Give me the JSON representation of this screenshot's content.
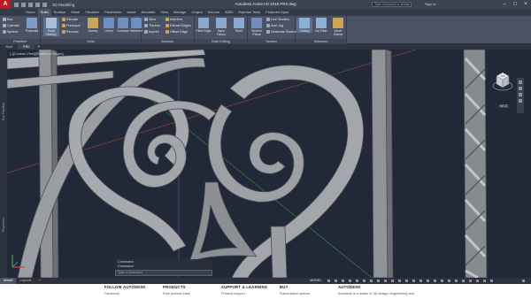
{
  "titlebar": {
    "app_logo": "A",
    "workspace": "3D Modeling",
    "title": "Autodesk AutoCAD 2019   PR2.dwg",
    "search_placeholder": "Type a keyword or phrase",
    "user": "Sign In",
    "minimize": "–",
    "maximize": "□",
    "close": "×"
  },
  "ribbon_tabs": [
    "Home",
    "Solid",
    "Surface",
    "Mesh",
    "Visualize",
    "Parametric",
    "Insert",
    "Annotate",
    "View",
    "Manage",
    "Output",
    "Add-ins",
    "A360",
    "Express Tools",
    "Featured Apps"
  ],
  "active_tab": "Solid",
  "ribbon": {
    "primitive": {
      "label": "Primitive",
      "items": [
        "Box",
        "Cylinder",
        "Sphere"
      ],
      "big": "Polysolid"
    },
    "solid": {
      "label": "Solid",
      "big": "Solid History",
      "items": [
        "Extrude",
        "Presspull",
        "Revolve"
      ],
      "items2": [
        "Sweep",
        "Union",
        "Subtract",
        "Intersect"
      ]
    },
    "boolean": {
      "label": "Boolean",
      "items": [
        "Slice",
        "Thicken",
        "Imprint"
      ],
      "items2": [
        "Interfere",
        "Extract Edges",
        "Offset Edge"
      ]
    },
    "solid_editing": {
      "label": "Solid Editing",
      "big": [
        "Fillet Edge",
        "Taper Faces",
        "Shell"
      ]
    },
    "section": {
      "label": "Section",
      "big": [
        "Section Plane"
      ],
      "items": [
        "Live Section",
        "Add Jog",
        "Generate Section"
      ]
    },
    "selection": {
      "label": "Selection",
      "big": [
        "Culling",
        "No Filter",
        "Move Gizmo"
      ]
    }
  },
  "file_tabs": [
    "Start",
    "PR2"
  ],
  "active_file": "PR2",
  "viewport": {
    "view_label": "[–][Custom View][Shaded w/ Edges]",
    "palette_top": "Tool Palettes",
    "palette_bottom": "Properties",
    "viewcube_face": "TOP",
    "wcs": "WCS"
  },
  "command": {
    "history": [
      "Command:",
      "Command:"
    ],
    "placeholder": "Type a command"
  },
  "status": {
    "layout_tabs": [
      "Model",
      "Layout1",
      "+"
    ],
    "active_layout": "Model",
    "space": "MODEL"
  },
  "footer": {
    "columns": [
      {
        "head": "FOLLOW AUTODESK",
        "link": "Facebook"
      },
      {
        "head": "PRODUCTS",
        "link": "Free product trials"
      },
      {
        "head": "SUPPORT & LEARNING",
        "link": "Product support"
      },
      {
        "head": "BUY",
        "link": "Subscription options"
      },
      {
        "head": "AUTODESK",
        "link": "Autodesk is a leader in 3D design, engineering and"
      }
    ]
  },
  "colors": {
    "accent": "#c4161c",
    "viewport_bg": "#212836",
    "metal": "#9b9fa4",
    "metal_dark": "#5f6368",
    "axis_red": "#b34a4a",
    "axis_green": "#3f8a4a"
  }
}
